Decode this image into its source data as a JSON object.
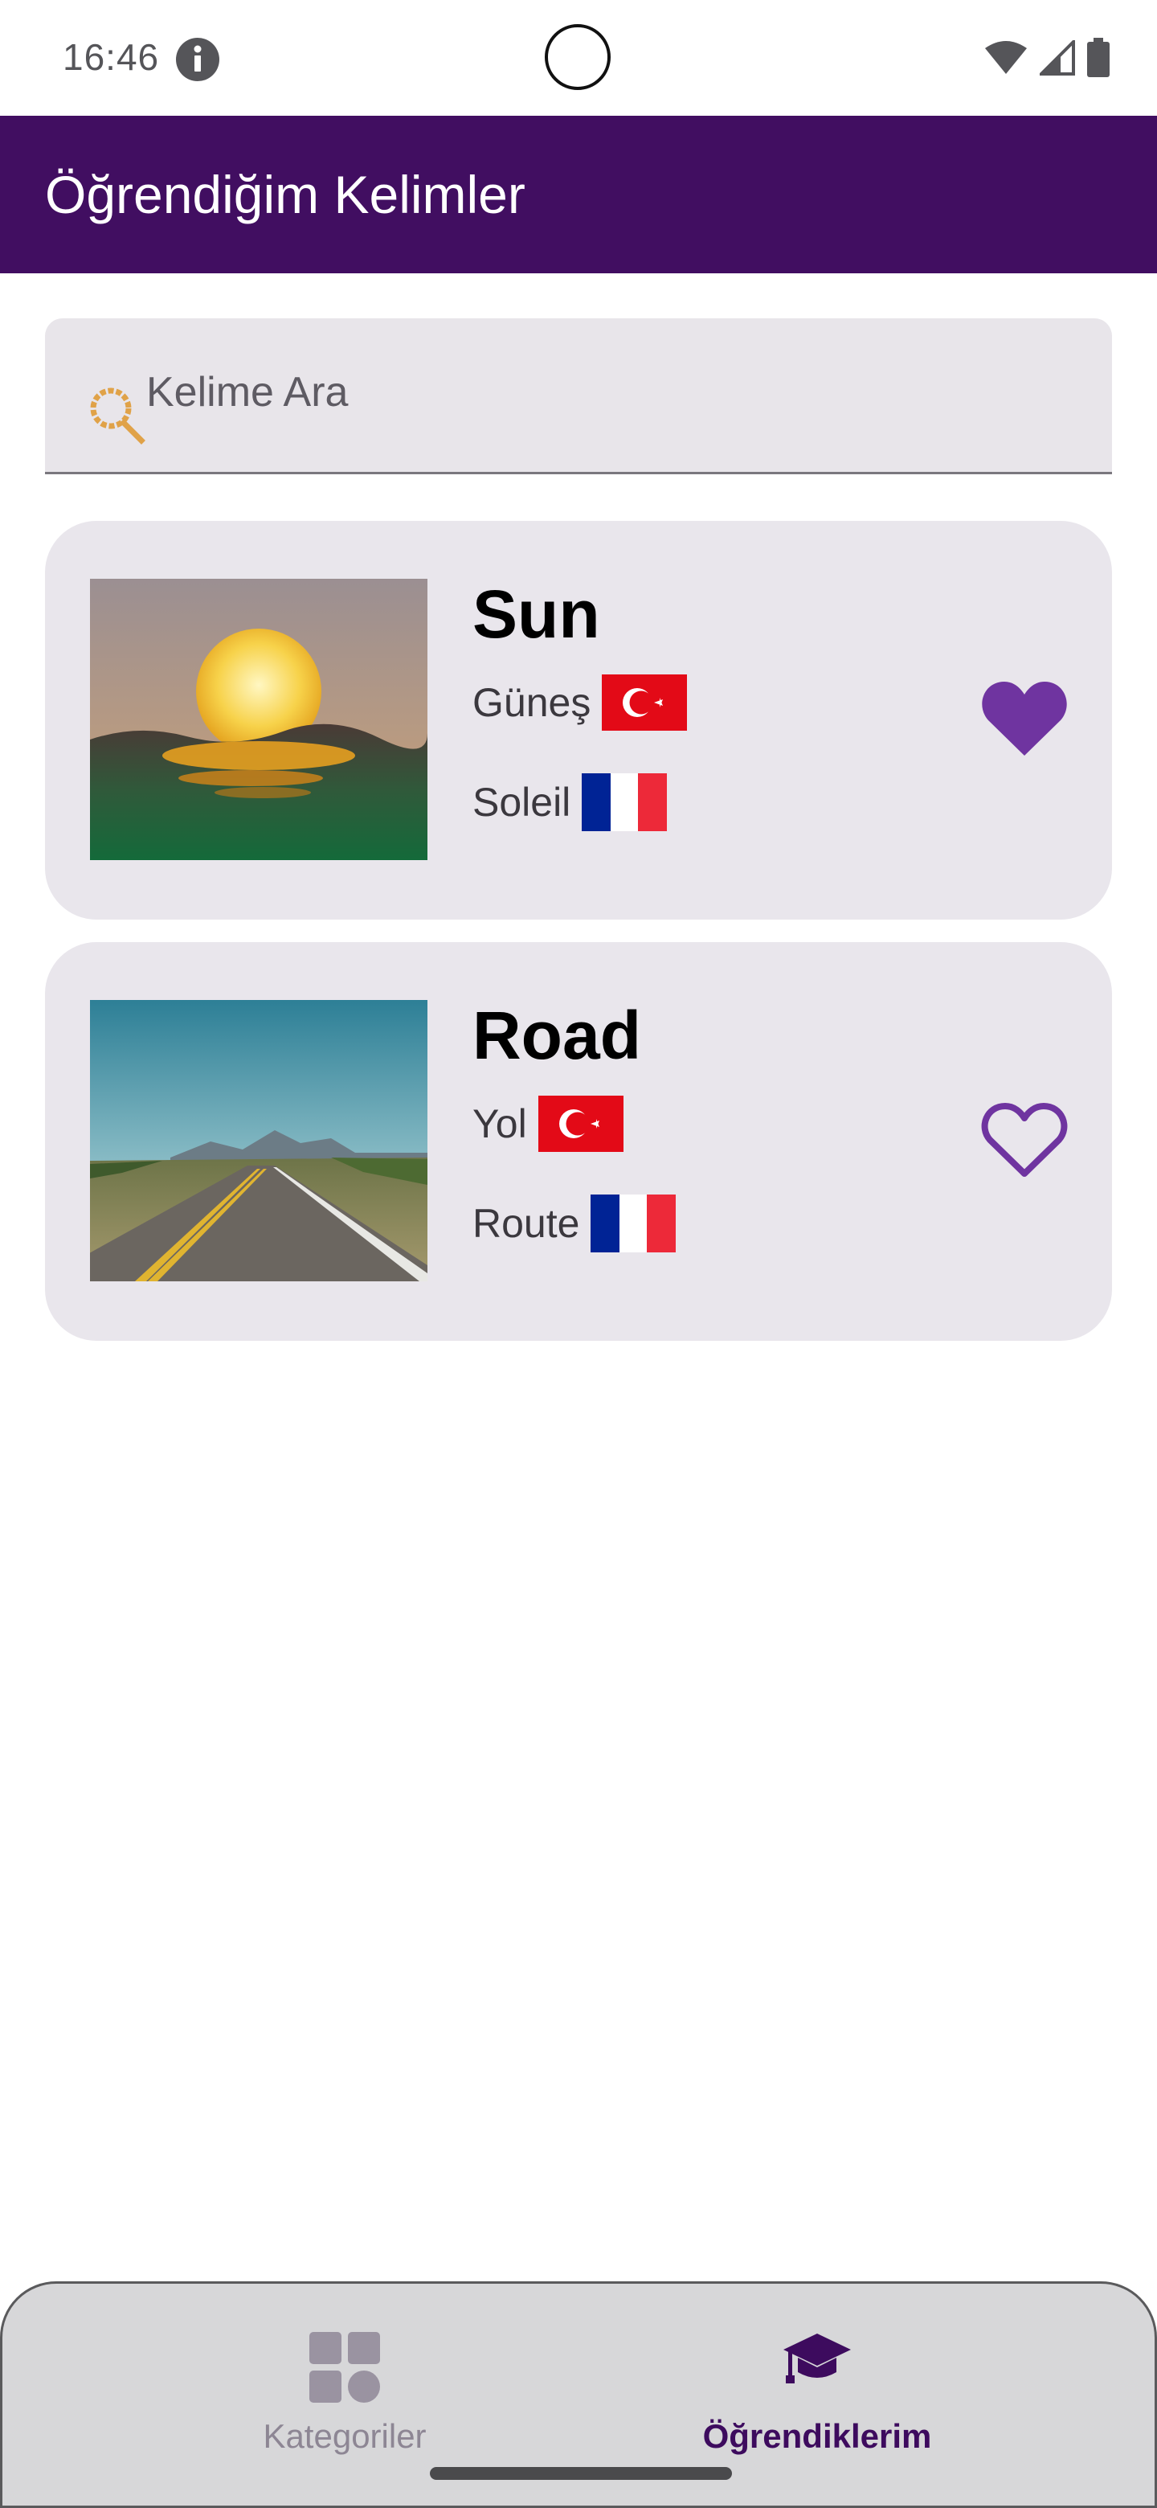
{
  "status_bar": {
    "time": "16:46",
    "icons": [
      "info-icon",
      "wifi-icon",
      "cell-signal-icon",
      "battery-icon"
    ]
  },
  "app_bar": {
    "title": "Öğrendiğim Kelimler",
    "background_color": "#410e61"
  },
  "search": {
    "placeholder": "Kelime Ara",
    "icon": "search-icon"
  },
  "words": [
    {
      "title": "Sun",
      "turkish": "Güneş",
      "french": "Soleil",
      "image": "sunset-over-sea",
      "favorite": true
    },
    {
      "title": "Road",
      "turkish": "Yol",
      "french": "Route",
      "image": "road-to-mountains",
      "favorite": false
    }
  ],
  "bottom_nav": {
    "items": [
      {
        "label": "Kategoriler",
        "icon": "grid-icon",
        "selected": false
      },
      {
        "label": "Öğrendiklerim",
        "icon": "graduation-cap-icon",
        "selected": true
      }
    ]
  },
  "colors": {
    "accent": "#6f34a0",
    "nav_selected": "#3d0b5e",
    "card_background": "#e9e6ec"
  }
}
